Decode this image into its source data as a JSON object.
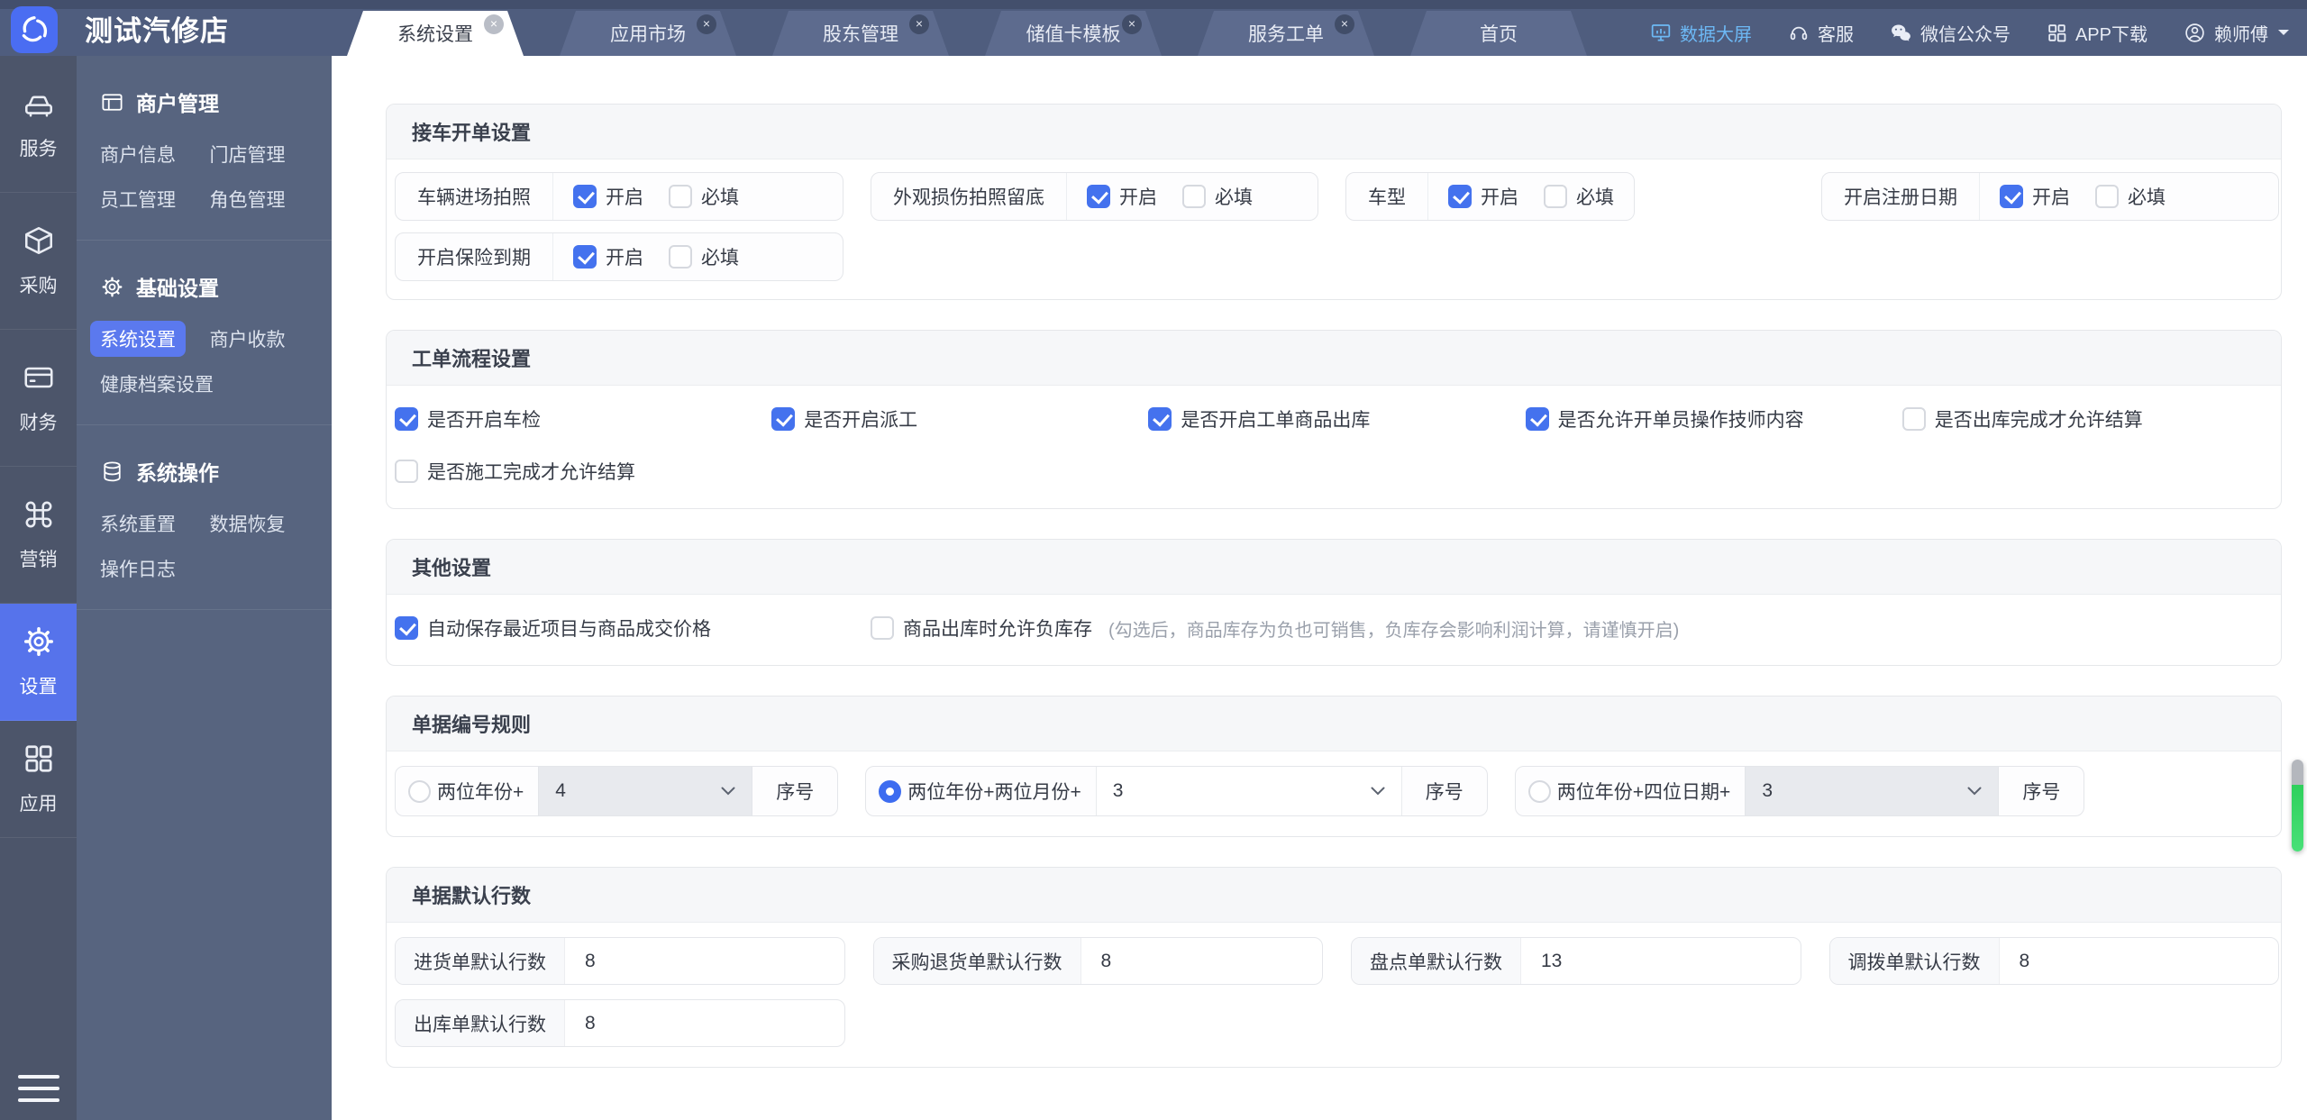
{
  "brand": {
    "name": "测试汽修店"
  },
  "tabs": {
    "close_glyph": "×",
    "items": [
      {
        "label": "系统设置",
        "active": true,
        "closable": true
      },
      {
        "label": "应用市场",
        "active": false,
        "closable": true
      },
      {
        "label": "股东管理",
        "active": false,
        "closable": true
      },
      {
        "label": "储值卡模板",
        "active": false,
        "closable": true
      },
      {
        "label": "服务工单",
        "active": false,
        "closable": true
      },
      {
        "label": "首页",
        "active": false,
        "closable": false
      }
    ]
  },
  "header_links": {
    "big_screen": {
      "label": "数据大屏"
    },
    "support": {
      "label": "客服"
    },
    "wechat": {
      "label": "微信公众号"
    },
    "app_download": {
      "label": "APP下载"
    },
    "user": {
      "label": "赖师傅"
    }
  },
  "nav_rail": {
    "items": [
      {
        "label": "服务",
        "icon": "car-icon",
        "active": false
      },
      {
        "label": "采购",
        "icon": "cube-icon",
        "active": false
      },
      {
        "label": "财务",
        "icon": "card-icon",
        "active": false
      },
      {
        "label": "营销",
        "icon": "command-icon",
        "active": false
      },
      {
        "label": "设置",
        "icon": "gear-icon",
        "active": true
      },
      {
        "label": "应用",
        "icon": "grid-icon",
        "active": false
      }
    ]
  },
  "submenu": {
    "sections": [
      {
        "title": "商户管理",
        "icon": "window-icon",
        "items": [
          {
            "label": "商户信息"
          },
          {
            "label": "门店管理"
          },
          {
            "label": "员工管理"
          },
          {
            "label": "角色管理"
          }
        ]
      },
      {
        "title": "基础设置",
        "icon": "gear-icon",
        "items": [
          {
            "label": "系统设置",
            "active": true
          },
          {
            "label": "商户收款"
          },
          {
            "label": "健康档案设置"
          }
        ]
      },
      {
        "title": "系统操作",
        "icon": "database-icon",
        "items": [
          {
            "label": "系统重置"
          },
          {
            "label": "数据恢复"
          },
          {
            "label": "操作日志"
          }
        ]
      }
    ]
  },
  "labels": {
    "on": "开启",
    "required": "必填",
    "serial": "序号"
  },
  "panels": {
    "reception": {
      "title": "接车开单设置",
      "items": [
        {
          "label": "车辆进场拍照",
          "on": true,
          "required": false
        },
        {
          "label": "外观损伤拍照留底",
          "on": true,
          "required": false
        },
        {
          "label": "车型",
          "on": true,
          "required": false
        },
        {
          "label": "开启注册日期",
          "on": true,
          "required": false
        },
        {
          "label": "开启保险到期",
          "on": true,
          "required": false
        }
      ]
    },
    "workflow": {
      "title": "工单流程设置",
      "items": [
        {
          "label": "是否开启车检",
          "checked": true
        },
        {
          "label": "是否开启派工",
          "checked": true
        },
        {
          "label": "是否开启工单商品出库",
          "checked": true
        },
        {
          "label": "是否允许开单员操作技师内容",
          "checked": true
        },
        {
          "label": "是否出库完成才允许结算",
          "checked": false
        },
        {
          "label": "是否施工完成才允许结算",
          "checked": false
        }
      ]
    },
    "other": {
      "title": "其他设置",
      "items": [
        {
          "label": "自动保存最近项目与商品成交价格",
          "checked": true,
          "note": ""
        },
        {
          "label": "商品出库时允许负库存",
          "checked": false,
          "note": "(勾选后，商品库存为负也可销售，负库存会影响利润计算，请谨慎开启)"
        }
      ]
    },
    "numbering": {
      "title": "单据编号规则",
      "options": [
        {
          "label": "两位年份+",
          "value": "4",
          "selected": false,
          "dim": true
        },
        {
          "label": "两位年份+两位月份+",
          "value": "3",
          "selected": true,
          "dim": false
        },
        {
          "label": "两位年份+四位日期+",
          "value": "3",
          "selected": false,
          "dim": true
        }
      ]
    },
    "defaults": {
      "title": "单据默认行数",
      "fields": [
        {
          "label": "进货单默认行数",
          "value": "8"
        },
        {
          "label": "采购退货单默认行数",
          "value": "8"
        },
        {
          "label": "盘点单默认行数",
          "value": "13"
        },
        {
          "label": "调拨单默认行数",
          "value": "8"
        },
        {
          "label": "出库单默认行数",
          "value": "8"
        }
      ]
    }
  },
  "colors": {
    "accent": "#4472ee",
    "rail_active": "#5673eb",
    "link_highlight": "#6db9f5",
    "scroll_green": "#35d263"
  }
}
